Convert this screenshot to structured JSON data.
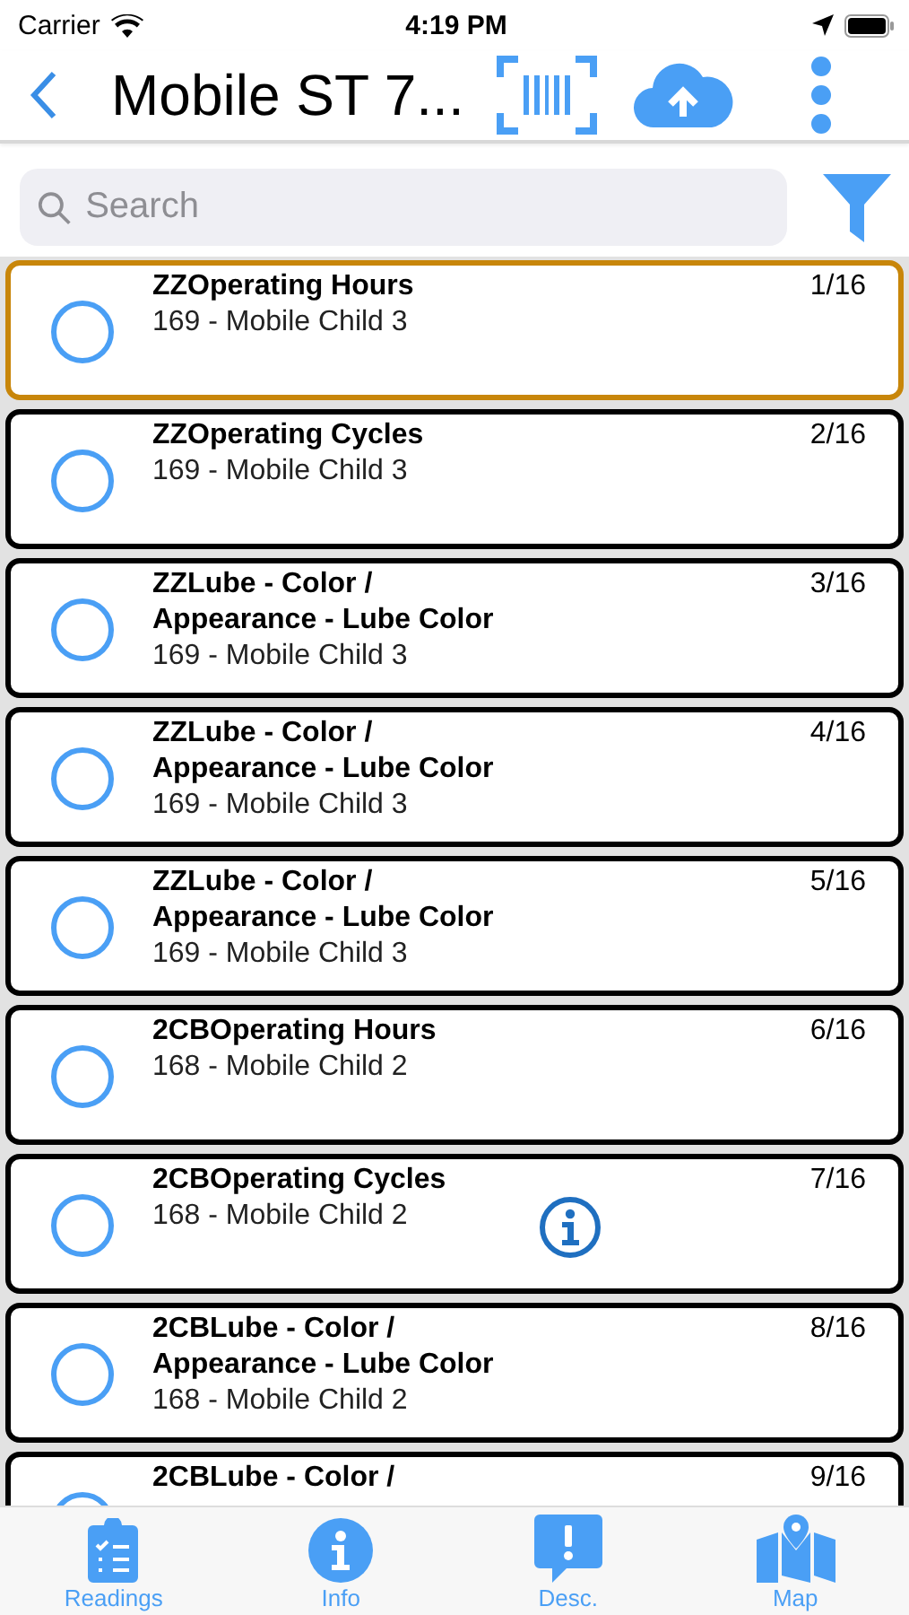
{
  "status_bar": {
    "carrier": "Carrier",
    "time": "4:19 PM"
  },
  "nav": {
    "title": "Mobile ST 7..."
  },
  "search": {
    "placeholder": "Search"
  },
  "items": [
    {
      "title": "ZZOperating Hours",
      "subtitle": "169 - Mobile Child 3",
      "count": "1/16",
      "selected": true,
      "info": false
    },
    {
      "title": "ZZOperating Cycles",
      "subtitle": "169 - Mobile Child 3",
      "count": "2/16",
      "selected": false,
      "info": false
    },
    {
      "title": "ZZLube - Color / Appearance - Lube Color",
      "subtitle": "169 - Mobile Child 3",
      "count": "3/16",
      "selected": false,
      "info": false
    },
    {
      "title": "ZZLube - Color / Appearance - Lube Color",
      "subtitle": "169 - Mobile Child 3",
      "count": "4/16",
      "selected": false,
      "info": false
    },
    {
      "title": "ZZLube - Color / Appearance - Lube Color",
      "subtitle": "169 - Mobile Child 3",
      "count": "5/16",
      "selected": false,
      "info": false
    },
    {
      "title": "2CBOperating Hours",
      "subtitle": "168 - Mobile Child 2",
      "count": "6/16",
      "selected": false,
      "info": false
    },
    {
      "title": "2CBOperating Cycles",
      "subtitle": "168 - Mobile Child 2",
      "count": "7/16",
      "selected": false,
      "info": true
    },
    {
      "title": "2CBLube - Color / Appearance - Lube Color",
      "subtitle": "168 - Mobile Child 2",
      "count": "8/16",
      "selected": false,
      "info": false
    },
    {
      "title": "2CBLube - Color /",
      "count": "9/16",
      "selected": false,
      "info": false
    }
  ],
  "tabs": [
    {
      "label": "Readings",
      "kind": "readings"
    },
    {
      "label": "Info",
      "kind": "info"
    },
    {
      "label": "Desc.",
      "kind": "desc"
    },
    {
      "label": "Map",
      "kind": "map"
    }
  ]
}
